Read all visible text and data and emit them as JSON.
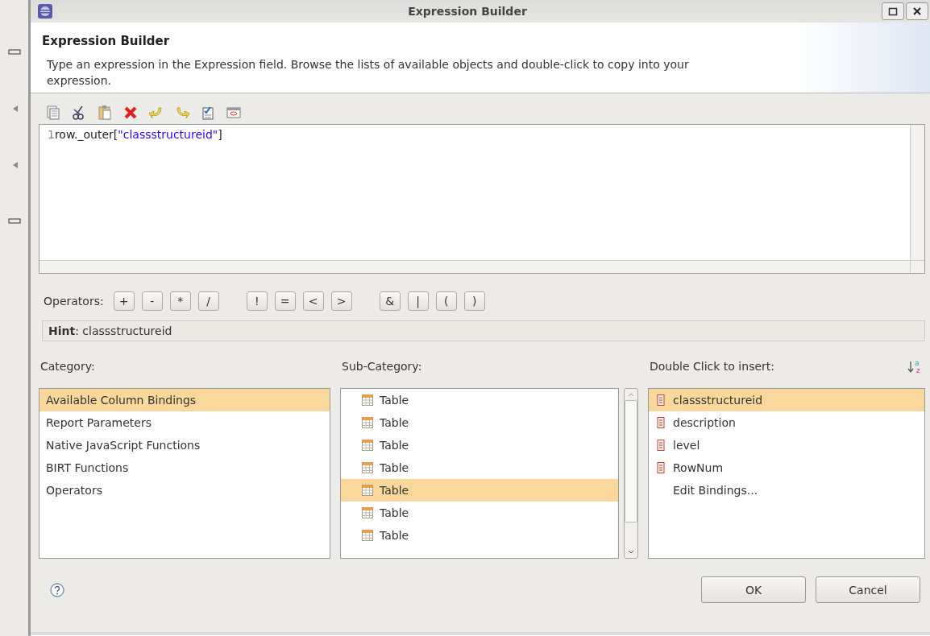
{
  "window": {
    "title": "Expression Builder"
  },
  "header": {
    "title": "Expression Builder",
    "description": "Type an expression in the Expression field. Browse the lists of available objects and double-click to copy into your expression."
  },
  "editor": {
    "line_number": "1",
    "tokens": [
      {
        "kind": "plain",
        "text": "row._outer["
      },
      {
        "kind": "string",
        "text": "\"classstructureid\""
      },
      {
        "kind": "plain",
        "text": "]"
      }
    ]
  },
  "operators": {
    "label": "Operators:",
    "groups": [
      [
        "+",
        "-",
        "*",
        "/"
      ],
      [
        "!",
        "=",
        "<",
        ">"
      ],
      [
        "&",
        "|",
        "(",
        ")"
      ]
    ]
  },
  "hint": "**Hint**: classstructureid",
  "category": {
    "label": "Category:",
    "items": [
      {
        "text": "Available Column Bindings",
        "selected": true
      },
      {
        "text": "Report Parameters",
        "selected": false
      },
      {
        "text": "Native JavaScript Functions",
        "selected": false
      },
      {
        "text": "BIRT Functions",
        "selected": false
      },
      {
        "text": "Operators",
        "selected": false
      }
    ]
  },
  "sub_category": {
    "label": "Sub-Category:",
    "items": [
      {
        "text": "Table",
        "selected": false
      },
      {
        "text": "Table",
        "selected": false
      },
      {
        "text": "Table",
        "selected": false
      },
      {
        "text": "Table",
        "selected": false
      },
      {
        "text": "Table",
        "selected": true
      },
      {
        "text": "Table",
        "selected": false
      },
      {
        "text": "Table",
        "selected": false
      }
    ]
  },
  "insert": {
    "label": "Double Click to insert:",
    "sort_letters": [
      "a",
      "z"
    ],
    "items": [
      {
        "kind": "binding",
        "text": "classstructureid",
        "selected": true
      },
      {
        "kind": "binding",
        "text": "description",
        "selected": false
      },
      {
        "kind": "binding",
        "text": "level",
        "selected": false
      },
      {
        "kind": "binding",
        "text": "RowNum",
        "selected": false
      },
      {
        "kind": "action",
        "text": "Edit Bindings...",
        "selected": false
      }
    ]
  },
  "buttons": [
    "OK",
    "Cancel"
  ]
}
